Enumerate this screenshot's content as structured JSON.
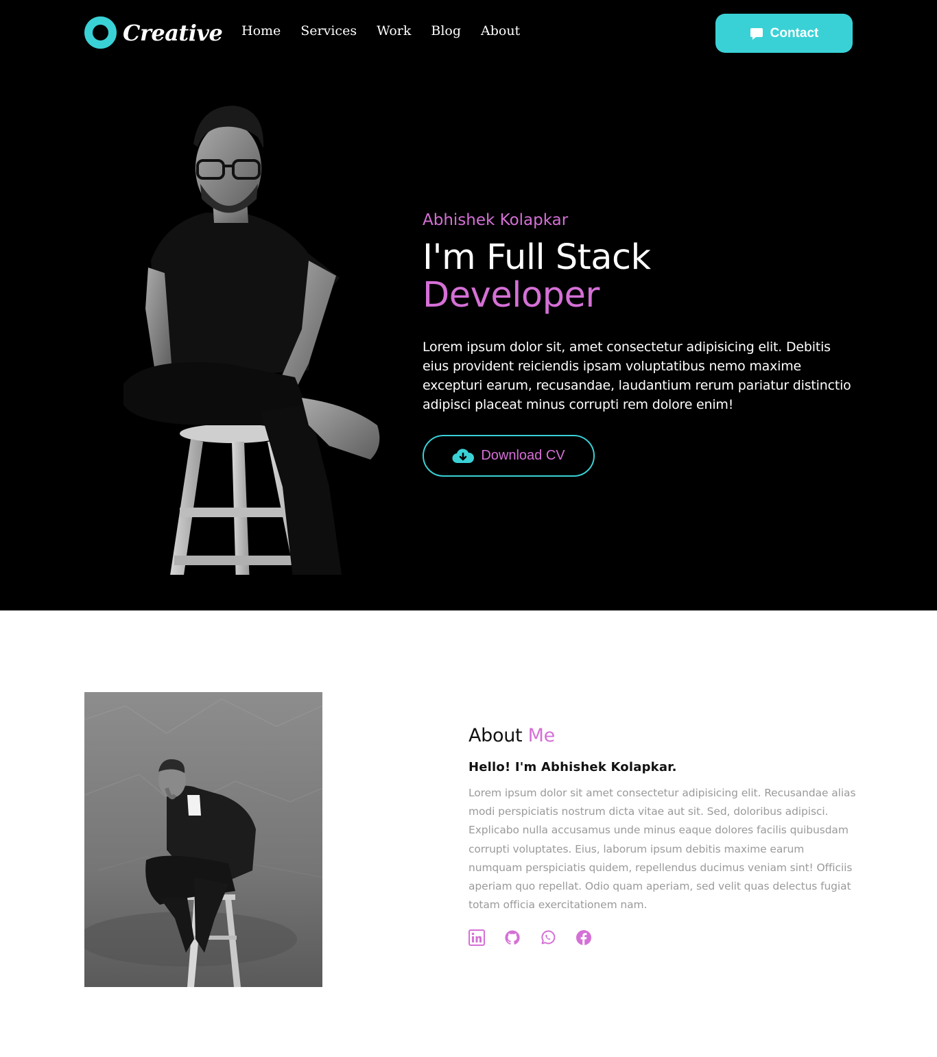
{
  "brand": {
    "name": "Creative",
    "accent_color": "#3ad1d6",
    "highlight_color": "#d570d6"
  },
  "nav": {
    "links": [
      "Home",
      "Services",
      "Work",
      "Blog",
      "About"
    ],
    "contact_label": "Contact",
    "contact_icon": "chat-bubble-icon"
  },
  "hero": {
    "name": "Abhishek Kolapkar",
    "title_line1": "I'm Full Stack",
    "title_line2": "Developer",
    "description": "Lorem ipsum dolor sit, amet consectetur adipisicing elit. Debitis eius provident reiciendis ipsam voluptatibus nemo maxime excepturi earum, recusandae, laudantium rerum pariatur distinctio adipisci placeat minus corrupti rem dolore enim!",
    "cv_label": "Download CV",
    "cv_icon": "cloud-download-icon"
  },
  "about": {
    "heading_plain": "About",
    "heading_accent": "Me",
    "hello": "Hello! I'm Abhishek Kolapkar.",
    "description": "Lorem ipsum dolor sit amet consectetur adipisicing elit. Recusandae alias modi perspiciatis nostrum dicta vitae aut sit. Sed, doloribus adipisci. Explicabo nulla accusamus unde minus eaque dolores facilis quibusdam corrupti voluptates. Eius, laborum ipsum debitis maxime earum numquam perspiciatis quidem, repellendus ducimus veniam sint! Officiis aperiam quo repellat. Odio quam aperiam, sed velit quas delectus fugiat totam officia exercitationem nam.",
    "socials": [
      "linkedin-icon",
      "github-icon",
      "whatsapp-icon",
      "facebook-icon"
    ]
  }
}
